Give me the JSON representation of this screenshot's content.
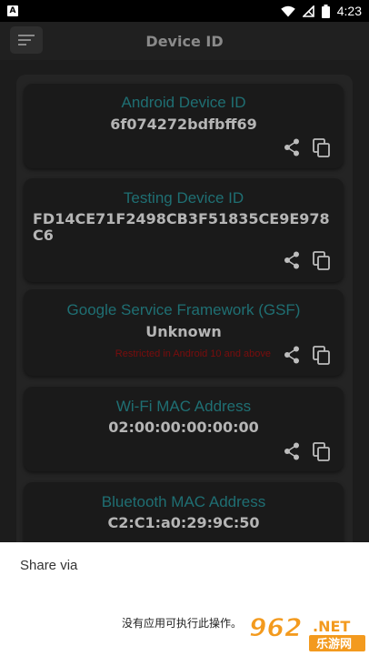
{
  "status_bar": {
    "time": "4:23",
    "left_icon": "A"
  },
  "app_bar": {
    "title": "Device ID"
  },
  "cards": [
    {
      "label": "Android Device ID",
      "value": "6f074272bdfbff69",
      "note": ""
    },
    {
      "label": "Testing Device ID",
      "value": "FD14CE71F2498CB3F51835CE9E978C6",
      "note": ""
    },
    {
      "label": "Google Service Framework (GSF)",
      "value": "Unknown",
      "note": "Restricted in Android 10 and above"
    },
    {
      "label": "Wi-Fi MAC Address",
      "value": "02:00:00:00:00:00",
      "note": ""
    },
    {
      "label": "Bluetooth MAC Address",
      "value": "C2:C1:a0:29:9C:50",
      "note": ""
    }
  ],
  "share_sheet": {
    "title": "Share via",
    "empty_text": "没有应用可执行此操作。"
  },
  "watermark": {
    "number": "962",
    "suffix": ".NET",
    "cn": "乐游网"
  },
  "colors": {
    "label": "#1f6f73",
    "value": "#b5b5b5",
    "note": "#7a0d0d",
    "watermark": "#f39a1e"
  }
}
